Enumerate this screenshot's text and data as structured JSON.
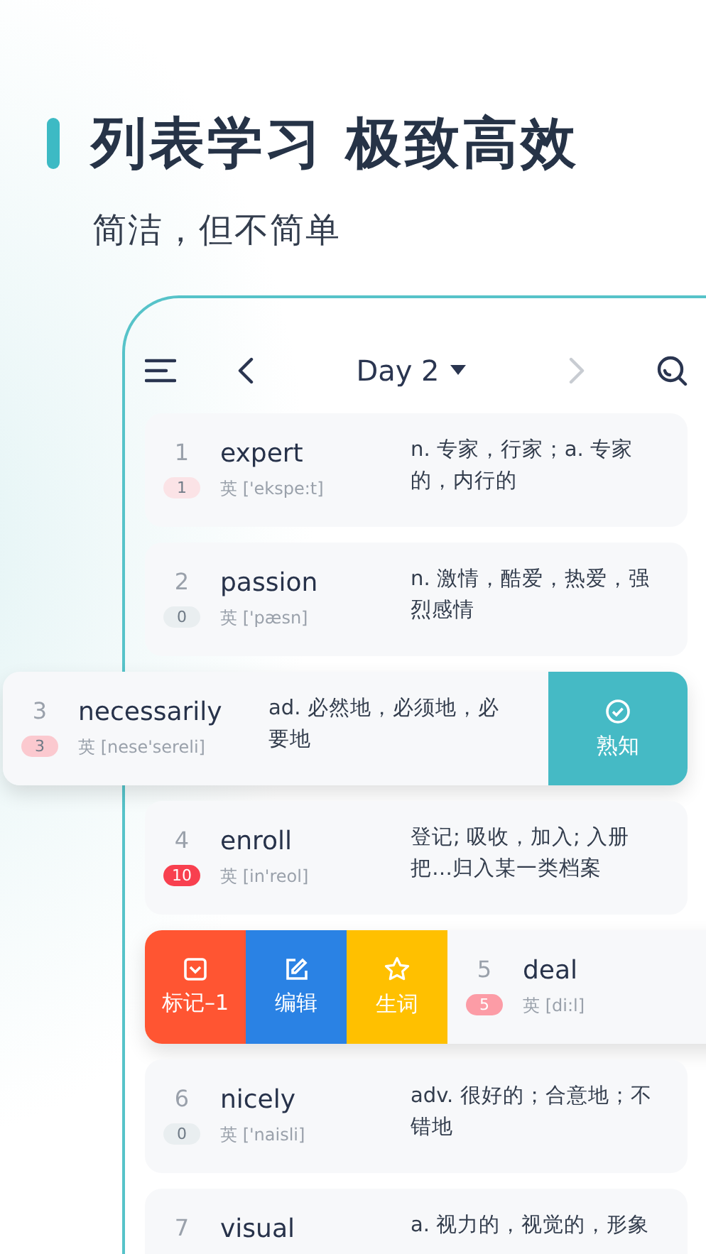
{
  "headline": {
    "title": "列表学习 极致高效",
    "subtitle": "简洁，但不简单"
  },
  "toolbar": {
    "day": "Day 2",
    "next_disabled": true
  },
  "rows": [
    {
      "kind": "normal",
      "number": "1",
      "word": "expert",
      "phonetic": "英 ['ekspe:t]",
      "definition": "n. 专家，行家；a. 专家的，内行的",
      "count": "1",
      "color": "#fbe3e6"
    },
    {
      "kind": "normal",
      "number": "2",
      "word": "passion",
      "phonetic": "英 ['pæsn]",
      "definition": "n. 激情，酷爱，热爱，强烈感情",
      "count": "0",
      "color": "#e9eef0"
    },
    {
      "kind": "swiped_left",
      "number": "3",
      "word": "necessarily",
      "phonetic": "英 [nese'sereli]",
      "definition": "ad. 必然地，必须地，必要地",
      "count": "3",
      "color": "#fbc9cf",
      "actions": [
        {
          "kind": "known",
          "label": "熟知",
          "color": "#45bac5"
        }
      ]
    },
    {
      "kind": "normal",
      "number": "4",
      "word": "enroll",
      "phonetic": "英 [in'reol]",
      "definition": "登记; 吸收，加入; 入册把…归入某一类档案",
      "count": "10",
      "color": "#f8404f"
    },
    {
      "kind": "swiped_right",
      "number": "5",
      "word": "deal",
      "phonetic": "英 [di:l]",
      "count": "5",
      "color": "#fc9ca6",
      "actions": [
        {
          "kind": "mark",
          "label": "标记–1",
          "color": "#ff5532"
        },
        {
          "kind": "edit",
          "label": "编辑",
          "color": "#2a82e4"
        },
        {
          "kind": "new_word",
          "label": "生词",
          "color": "#ffc000"
        }
      ]
    },
    {
      "kind": "normal",
      "number": "6",
      "word": "nicely",
      "phonetic": "英 ['naisli]",
      "definition": "adv. 很好的；合意地；不错地",
      "count": "0",
      "color": "#e9eef0"
    },
    {
      "kind": "normal",
      "number": "7",
      "word": "visual",
      "definition": "a. 视力的，视觉的，形象"
    }
  ]
}
